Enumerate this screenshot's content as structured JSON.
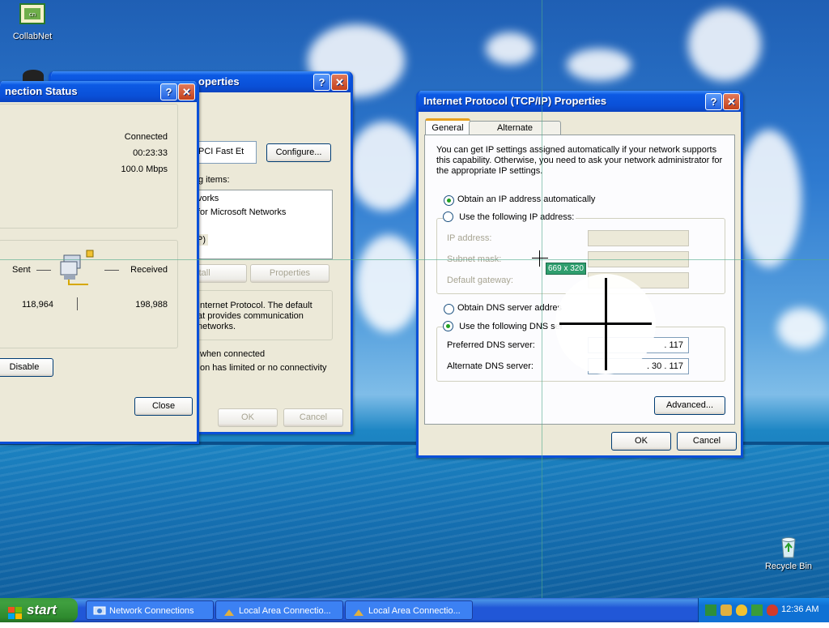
{
  "desktop": {
    "icons": [
      {
        "label": "CollabNet",
        "icon": "collabnet-icon"
      },
      {
        "label": "Recycle Bin",
        "icon": "recycle-bin-icon"
      }
    ]
  },
  "status_window": {
    "title": "nection Status",
    "connected": "Connected",
    "duration": "00:23:33",
    "speed": "100.0 Mbps",
    "sent_label": "Sent",
    "received_label": "Received",
    "sent_value": "118,964",
    "received_value": "198,988",
    "disable_label": "Disable",
    "close_label": "Close"
  },
  "props_window": {
    "title": "operties",
    "adapter": "PCI Fast Et",
    "configure_label": "Configure...",
    "items_label": "g items:",
    "items": [
      "vorks",
      "for Microsoft Networks",
      "P)"
    ],
    "install_label": "nstall",
    "properties_label": "Properties",
    "description": [
      "Internet Protocol. The default",
      "at provides communication",
      "networks."
    ],
    "notify_connected": "when connected",
    "notify_limited": "on has limited or no connectivity",
    "ok_label": "OK",
    "cancel_label": "Cancel"
  },
  "tcpip_window": {
    "title": "Internet Protocol (TCP/IP) Properties",
    "tab_general": "General",
    "tab_alternate": "Alternate Configuration",
    "intro": [
      "You can get IP settings assigned automatically if your network supports",
      "this capability. Otherwise, you need to ask your network administrator for",
      "the appropriate IP settings."
    ],
    "obtain_ip": "Obtain an IP address automatically",
    "use_ip": "Use the following IP address:",
    "ip_address": "IP address:",
    "subnet_mask": "Subnet mask:",
    "default_gateway": "Default gateway:",
    "obtain_dns": "Obtain DNS server addres",
    "use_dns": "Use the following DNS ser",
    "preferred_dns": "Preferred DNS server:",
    "alternate_dns": "Alternate DNS server:",
    "preferred_dns_value": ". 117",
    "alternate_dns_value": ". 30 . 117",
    "advanced_label": "Advanced...",
    "ok_label": "OK",
    "cancel_label": "Cancel"
  },
  "overlay": {
    "coords": "669 x 320"
  },
  "taskbar": {
    "start_label": "start",
    "items": [
      {
        "label": "Network Connections",
        "icon": "network-connections-icon"
      },
      {
        "label": "Local Area Connectio...",
        "icon": "lan-icon"
      },
      {
        "label": "Local Area Connectio...",
        "icon": "lan-icon"
      }
    ],
    "clock": "12:36 AM"
  }
}
